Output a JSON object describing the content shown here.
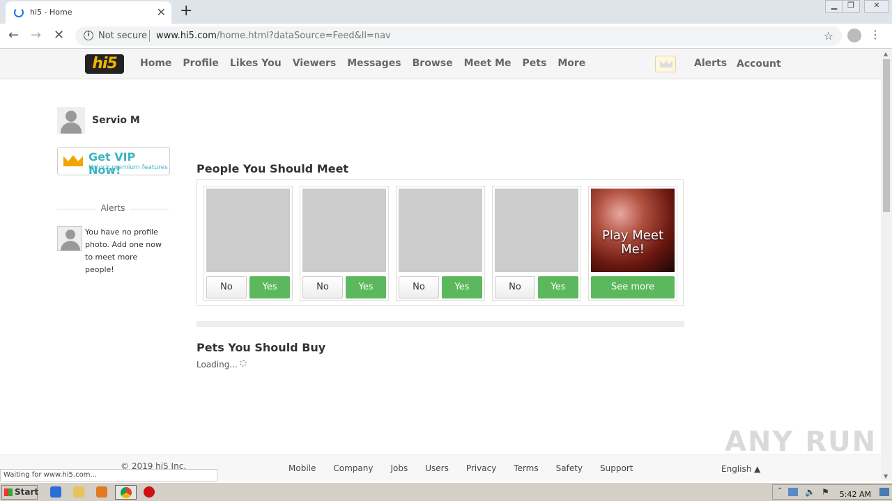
{
  "browser": {
    "tab_title": "hi5 - Home",
    "new_tab": "+",
    "tab_close": "✕",
    "not_secure": "Not secure",
    "url_host": "www.hi5.com",
    "url_path": "/home.html?dataSource=Feed&ll=nav",
    "status_text": "Waiting for www.hi5.com..."
  },
  "nav": {
    "logo": "hi5",
    "links": [
      "Home",
      "Profile",
      "Likes You",
      "Viewers",
      "Messages",
      "Browse",
      "Meet Me",
      "Pets",
      "More"
    ],
    "alerts": "Alerts",
    "account": "Account"
  },
  "sidebar": {
    "username": "Servio M",
    "vip_title": "Get VIP Now!",
    "vip_subtitle": "Unlock premium features",
    "alerts_heading": "Alerts",
    "alert_text": "You have no profile photo. Add one now to meet more people!"
  },
  "main": {
    "meet_title": "People You Should Meet",
    "no_label": "No",
    "yes_label": "Yes",
    "play_text": "Play Meet Me!",
    "see_more": "See more",
    "pets_title": "Pets You Should Buy",
    "loading": "Loading..."
  },
  "footer": {
    "copyright": "© 2019 hi5 Inc.",
    "links": [
      "Mobile",
      "Company",
      "Jobs",
      "Users",
      "Privacy",
      "Terms",
      "Safety",
      "Support"
    ],
    "language": "English ▲"
  },
  "watermark": "ANY RUN",
  "taskbar": {
    "start": "Start",
    "clock": "5:42 AM"
  },
  "colors": {
    "accent_green": "#5cb85c",
    "vip_teal": "#3bb4c1",
    "logo_yellow": "#f4b400"
  }
}
